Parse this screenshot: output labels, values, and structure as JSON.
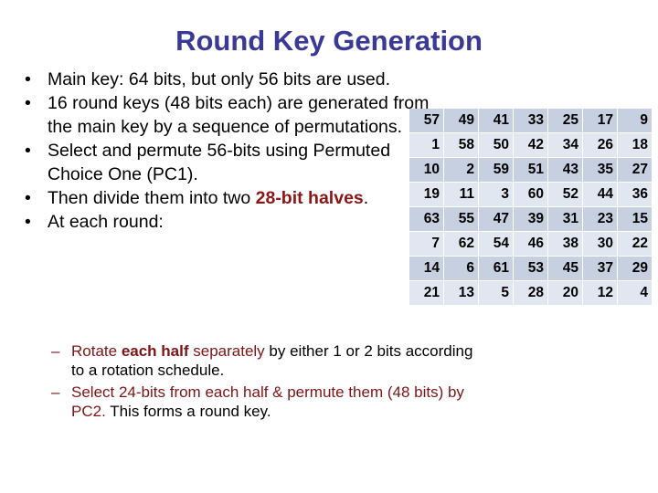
{
  "slide": {
    "title": "Round Key Generation"
  },
  "bullets": [
    {
      "marker": "•",
      "segments": [
        {
          "text": "Main key: 64 bits, but only 56 bits are used.",
          "style": "plain"
        }
      ]
    },
    {
      "marker": "•",
      "segments": [
        {
          "text": "16 round keys (48 bits each) are generated from the main key by a sequence of permutations.",
          "style": "plain"
        }
      ]
    },
    {
      "marker": "•",
      "segments": [
        {
          "text": "Select and permute 56-bits using Permuted Choice One (PC1).",
          "style": "plain"
        }
      ]
    },
    {
      "marker": "•",
      "segments": [
        {
          "text": "Then divide them into two ",
          "style": "plain"
        },
        {
          "text": "28-bit halves",
          "style": "em-red"
        },
        {
          "text": ".",
          "style": "plain"
        }
      ]
    },
    {
      "marker": "•",
      "segments": [
        {
          "text": "At each round:",
          "style": "plain"
        }
      ]
    }
  ],
  "sub_bullets": [
    {
      "marker": "–",
      "segments": [
        {
          "text": "Rotate ",
          "style": "red"
        },
        {
          "text": "each half",
          "style": "red-bold"
        },
        {
          "text": " separately",
          "style": "red"
        },
        {
          "text": " by either 1 or 2 bits according to a rotation schedule.",
          "style": "blk"
        }
      ]
    },
    {
      "marker": "–",
      "segments": [
        {
          "text": "Select 24-bits from each half & permute them (48 bits) by PC2.",
          "style": "red"
        },
        {
          "text": "  This forms a round key.",
          "style": "blk"
        }
      ]
    }
  ],
  "pc1_table": {
    "caption": "Permuted Choice One (PC1)",
    "rows": [
      [
        57,
        49,
        41,
        33,
        25,
        17,
        9
      ],
      [
        1,
        58,
        50,
        42,
        34,
        26,
        18
      ],
      [
        10,
        2,
        59,
        51,
        43,
        35,
        27
      ],
      [
        19,
        11,
        3,
        60,
        52,
        44,
        36
      ],
      [
        63,
        55,
        47,
        39,
        31,
        23,
        15
      ],
      [
        7,
        62,
        54,
        46,
        38,
        30,
        22
      ],
      [
        14,
        6,
        61,
        53,
        45,
        37,
        29
      ],
      [
        21,
        13,
        5,
        28,
        20,
        12,
        4
      ]
    ]
  },
  "colors": {
    "title": "#3a3a96",
    "accent_red": "#8c1515",
    "sub_red": "#7e1416",
    "row_dark": "#c6d0e0",
    "row_light": "#e1e7f1",
    "background": "#ffffff"
  }
}
